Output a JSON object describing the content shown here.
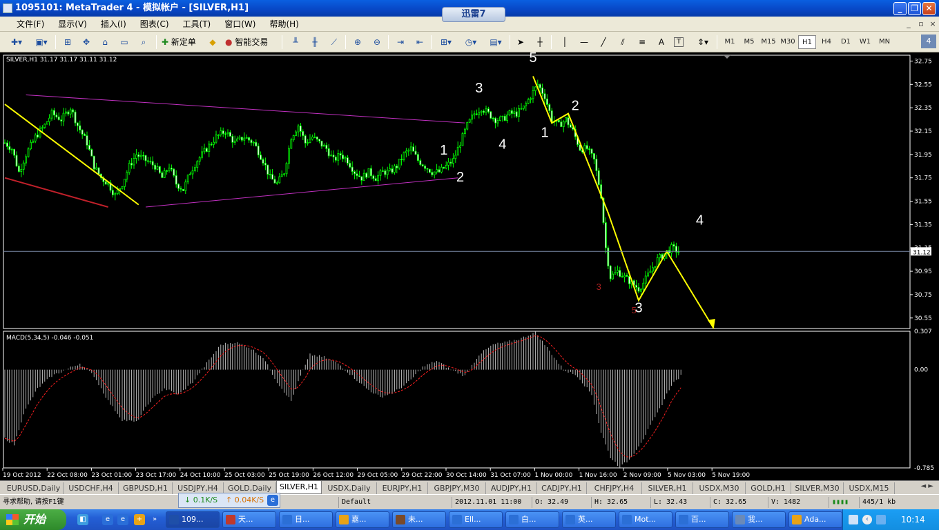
{
  "window": {
    "title": "1095101: MetaTrader 4 - 模拟帐户 - [SILVER,H1]",
    "overlay_badge": "迅雷7",
    "buttons": {
      "minimize": "_",
      "restore": "❐",
      "close": "✕"
    }
  },
  "menu": {
    "items": [
      "文件(F)",
      "显示(V)",
      "插入(I)",
      "图表(C)",
      "工具(T)",
      "窗口(W)",
      "帮助(H)"
    ],
    "mdi": {
      "minimize": "_",
      "restore": "▫",
      "close": "×"
    }
  },
  "toolbar": {
    "new_order": "新定单",
    "expert_advisors": "智能交易",
    "text_tool": "A",
    "label_tool": "T",
    "timeframes": [
      "M1",
      "M5",
      "M15",
      "M30",
      "H1",
      "H4",
      "D1",
      "W1",
      "MN"
    ],
    "active_timeframe": "H1",
    "window_count": "4"
  },
  "chart_data": [
    {
      "type": "candlestick",
      "title": "SILVER,H1  31.17 31.17 31.11 31.12",
      "symbol": "SILVER",
      "timeframe": "H1",
      "ohlc_label": "31.17 31.17 31.11 31.12",
      "ylim": [
        30.46,
        32.8
      ],
      "y_ticks": [
        "32.75",
        "32.55",
        "32.35",
        "32.15",
        "31.95",
        "31.75",
        "31.55",
        "31.35",
        "31.15",
        "30.95",
        "30.75",
        "30.55"
      ],
      "current_price": "31.12",
      "grid": false,
      "close_path": [
        [
          0,
          32.05
        ],
        [
          3,
          32.0
        ],
        [
          6,
          31.8
        ],
        [
          9,
          31.95
        ],
        [
          13,
          32.1
        ],
        [
          17,
          32.2
        ],
        [
          20,
          32.3
        ],
        [
          24,
          32.25
        ],
        [
          28,
          32.35
        ],
        [
          31,
          32.2
        ],
        [
          35,
          32.05
        ],
        [
          38,
          31.85
        ],
        [
          41,
          31.75
        ],
        [
          44,
          31.7
        ],
        [
          47,
          31.6
        ],
        [
          50,
          31.7
        ],
        [
          53,
          31.85
        ],
        [
          56,
          31.95
        ],
        [
          60,
          31.9
        ],
        [
          64,
          31.85
        ],
        [
          67,
          31.75
        ],
        [
          70,
          31.85
        ],
        [
          73,
          31.7
        ],
        [
          76,
          31.65
        ],
        [
          79,
          31.8
        ],
        [
          82,
          31.9
        ],
        [
          86,
          32.0
        ],
        [
          90,
          32.1
        ],
        [
          94,
          32.15
        ],
        [
          98,
          32.05
        ],
        [
          102,
          32.1
        ],
        [
          106,
          32.05
        ],
        [
          110,
          31.9
        ],
        [
          113,
          31.75
        ],
        [
          116,
          31.7
        ],
        [
          119,
          31.8
        ],
        [
          122,
          32.1
        ],
        [
          125,
          32.2
        ],
        [
          128,
          32.05
        ],
        [
          131,
          32.1
        ],
        [
          134,
          32.05
        ],
        [
          137,
          32.0
        ],
        [
          140,
          31.9
        ],
        [
          143,
          31.95
        ],
        [
          146,
          31.9
        ],
        [
          149,
          31.8
        ],
        [
          152,
          31.75
        ],
        [
          155,
          31.8
        ],
        [
          158,
          31.75
        ],
        [
          161,
          31.8
        ],
        [
          164,
          31.8
        ],
        [
          167,
          31.85
        ],
        [
          170,
          31.95
        ],
        [
          173,
          32.0
        ],
        [
          176,
          31.9
        ],
        [
          179,
          31.85
        ],
        [
          182,
          31.8
        ],
        [
          185,
          31.8
        ],
        [
          188,
          31.85
        ],
        [
          191,
          31.9
        ],
        [
          194,
          32.05
        ],
        [
          197,
          32.2
        ],
        [
          200,
          32.3
        ],
        [
          203,
          32.35
        ],
        [
          206,
          32.3
        ],
        [
          209,
          32.25
        ],
        [
          212,
          32.25
        ],
        [
          215,
          32.3
        ],
        [
          218,
          32.3
        ],
        [
          221,
          32.35
        ],
        [
          224,
          32.45
        ],
        [
          227,
          32.55
        ],
        [
          230,
          32.45
        ],
        [
          233,
          32.25
        ],
        [
          236,
          32.2
        ],
        [
          239,
          32.25
        ],
        [
          242,
          32.15
        ],
        [
          245,
          32.0
        ],
        [
          248,
          32.0
        ],
        [
          251,
          31.9
        ],
        [
          254,
          31.6
        ],
        [
          256,
          31.15
        ],
        [
          258,
          30.9
        ],
        [
          261,
          30.95
        ],
        [
          264,
          30.9
        ],
        [
          267,
          30.85
        ],
        [
          270,
          30.8
        ],
        [
          272,
          30.85
        ],
        [
          275,
          30.95
        ],
        [
          278,
          31.05
        ],
        [
          281,
          31.1
        ],
        [
          284,
          31.15
        ],
        [
          287,
          31.12
        ]
      ],
      "annotations": {
        "wave_labels": [
          {
            "text": "5",
            "bar": 225,
            "price": 32.74,
            "color": "#ffffff"
          },
          {
            "text": "3",
            "bar": 202,
            "price": 32.48,
            "color": "#ffffff"
          },
          {
            "text": "2",
            "bar": 243,
            "price": 32.33,
            "color": "#ffffff"
          },
          {
            "text": "4",
            "bar": 212,
            "price": 32.0,
            "color": "#ffffff"
          },
          {
            "text": "1",
            "bar": 230,
            "price": 32.1,
            "color": "#ffffff"
          },
          {
            "text": "1",
            "bar": 187,
            "price": 31.95,
            "color": "#ffffff"
          },
          {
            "text": "2",
            "bar": 194,
            "price": 31.72,
            "color": "#ffffff"
          },
          {
            "text": "4",
            "bar": 296,
            "price": 31.35,
            "color": "#ffffff"
          },
          {
            "text": "3",
            "bar": 253,
            "price": 30.79,
            "color": "#a82020"
          },
          {
            "text": "5",
            "bar": 268,
            "price": 30.59,
            "color": "#a82020"
          },
          {
            "text": "3",
            "bar": 270,
            "price": 30.6,
            "color": "#ffffff"
          }
        ],
        "lines": [
          {
            "color": "#ffff00",
            "width": 2,
            "points": [
              [
                0,
                32.38
              ],
              [
                57,
                31.52
              ]
            ]
          },
          {
            "color": "#c0202a",
            "width": 2,
            "points": [
              [
                0,
                31.75
              ],
              [
                44,
                31.5
              ]
            ]
          },
          {
            "color": "#c030c0",
            "width": 1,
            "points": [
              [
                9,
                32.46
              ],
              [
                196,
                32.22
              ]
            ]
          },
          {
            "color": "#c030c0",
            "width": 1,
            "points": [
              [
                60,
                31.5
              ],
              [
                193,
                31.75
              ]
            ]
          },
          {
            "color": "#ffff00",
            "width": 2,
            "points": [
              [
                225,
                32.62
              ],
              [
                233,
                32.22
              ],
              [
                240,
                32.3
              ],
              [
                257,
                31.45
              ],
              [
                270,
                30.7
              ],
              [
                282,
                31.12
              ],
              [
                302,
                30.46
              ]
            ]
          }
        ],
        "arrow_tip": [
          302,
          30.46
        ]
      },
      "price_line": 31.12
    },
    {
      "type": "bar",
      "title": "MACD(5,34,5) -0.046 -0.051",
      "ylim": [
        -0.785,
        0.307
      ],
      "y_ticks": [
        "0.307",
        "0.00",
        "-0.785"
      ],
      "series": [
        {
          "name": "MACD(5,34,5)",
          "values_path": [
            [
              0,
              -0.55
            ],
            [
              4,
              -0.6
            ],
            [
              8,
              -0.35
            ],
            [
              14,
              -0.15
            ],
            [
              20,
              -0.05
            ],
            [
              26,
              0.0
            ],
            [
              32,
              0.05
            ],
            [
              38,
              -0.05
            ],
            [
              44,
              -0.25
            ],
            [
              50,
              -0.4
            ],
            [
              56,
              -0.42
            ],
            [
              62,
              -0.25
            ],
            [
              68,
              -0.15
            ],
            [
              74,
              -0.2
            ],
            [
              80,
              -0.1
            ],
            [
              86,
              0.05
            ],
            [
              92,
              0.2
            ],
            [
              98,
              0.22
            ],
            [
              104,
              0.18
            ],
            [
              110,
              0.1
            ],
            [
              116,
              -0.1
            ],
            [
              122,
              -0.25
            ],
            [
              126,
              -0.05
            ],
            [
              130,
              0.12
            ],
            [
              136,
              0.1
            ],
            [
              142,
              0.05
            ],
            [
              148,
              -0.05
            ],
            [
              154,
              -0.15
            ],
            [
              160,
              -0.22
            ],
            [
              166,
              -0.18
            ],
            [
              172,
              -0.1
            ],
            [
              178,
              0.02
            ],
            [
              184,
              0.07
            ],
            [
              190,
              0.0
            ],
            [
              196,
              -0.05
            ],
            [
              202,
              0.12
            ],
            [
              208,
              0.2
            ],
            [
              214,
              0.22
            ],
            [
              220,
              0.25
            ],
            [
              226,
              0.3
            ],
            [
              232,
              0.15
            ],
            [
              238,
              0.0
            ],
            [
              244,
              -0.05
            ],
            [
              250,
              -0.2
            ],
            [
              254,
              -0.5
            ],
            [
              258,
              -0.7
            ],
            [
              262,
              -0.78
            ],
            [
              266,
              -0.72
            ],
            [
              272,
              -0.55
            ],
            [
              278,
              -0.35
            ],
            [
              284,
              -0.12
            ],
            [
              288,
              -0.05
            ]
          ]
        }
      ]
    }
  ],
  "x_axis_labels": [
    "19 Oct 2012",
    "22 Oct 08:00",
    "23 Oct 01:00",
    "23 Oct 17:00",
    "24 Oct 10:00",
    "25 Oct 03:00",
    "25 Oct 19:00",
    "26 Oct 12:00",
    "29 Oct 05:00",
    "29 Oct 22:00",
    "30 Oct 14:00",
    "31 Oct 07:00",
    "1 Nov 00:00",
    "1 Nov 16:00",
    "2 Nov 09:00",
    "5 Nov 03:00",
    "5 Nov 19:00"
  ],
  "chart_tabs": [
    "EURUSD,Daily",
    "USDCHF,H4",
    "GBPUSD,H1",
    "USDJPY,H4",
    "GOLD,Daily",
    "SILVER,H1",
    "USDX,Daily",
    "EURJPY,H1",
    "GBPJPY,M30",
    "AUDJPY,H1",
    "CADJPY,H1",
    "CHFJPY,H4",
    "SILVER,H1",
    "USDX,M30",
    "GOLD,H1",
    "SILVER,M30",
    "USDX,M15"
  ],
  "active_tab_index": 5,
  "tab_arrows": "◄ ►",
  "status": {
    "help": "寻求帮助, 请按F1键",
    "download": "↓ 0.1K/S",
    "upload": "↑ 0.04K/S",
    "profile": "Default",
    "datetime": "2012.11.01 11:00",
    "open": "O: 32.49",
    "high": "H: 32.65",
    "low": "L: 32.43",
    "close": "C: 32.65",
    "volume": "V: 1482",
    "traffic": "445/1 kb"
  },
  "taskbar": {
    "start_label": "开始",
    "more": "»",
    "tasks": [
      "109...",
      "天...",
      "日...",
      "嘉...",
      "未...",
      "Ell...",
      "白...",
      "英...",
      "Mot...",
      "百...",
      "我...",
      "Ada..."
    ],
    "clock": "10:14",
    "colors": [
      "#1e4fa8",
      "#c0392b",
      "#2b6fd6",
      "#e8a317",
      "#7a4a2a",
      "#2b6fd6",
      "#2b6fd6",
      "#2b6fd6",
      "#2b6fd6",
      "#2b6fd6",
      "#6a8ab8",
      "#e8a317"
    ]
  }
}
